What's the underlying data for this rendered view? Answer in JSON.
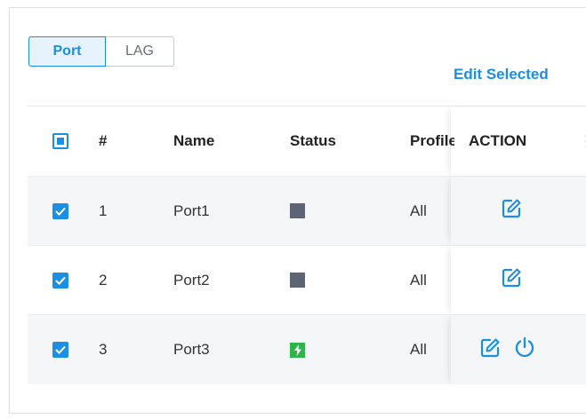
{
  "tabs": {
    "port_label": "Port",
    "lag_label": "LAG"
  },
  "toolbar": {
    "edit_selected_label": "Edit Selected"
  },
  "table": {
    "headers": {
      "number": "#",
      "name": "Name",
      "status": "Status",
      "profile": "Profile",
      "action": "ACTION"
    },
    "rows": [
      {
        "number": "1",
        "name": "Port1",
        "profile": "All",
        "checked": true,
        "status": "down",
        "actions": [
          "edit-icon"
        ]
      },
      {
        "number": "2",
        "name": "Port2",
        "profile": "All",
        "checked": true,
        "status": "down",
        "actions": [
          "edit-icon"
        ]
      },
      {
        "number": "3",
        "name": "Port3",
        "profile": "All",
        "checked": true,
        "status": "up",
        "actions": [
          "edit-icon",
          "power-icon"
        ]
      }
    ]
  },
  "colors": {
    "accent": "#1a8fe3",
    "status_down": "#5d6575",
    "status_up": "#2fb44a"
  }
}
